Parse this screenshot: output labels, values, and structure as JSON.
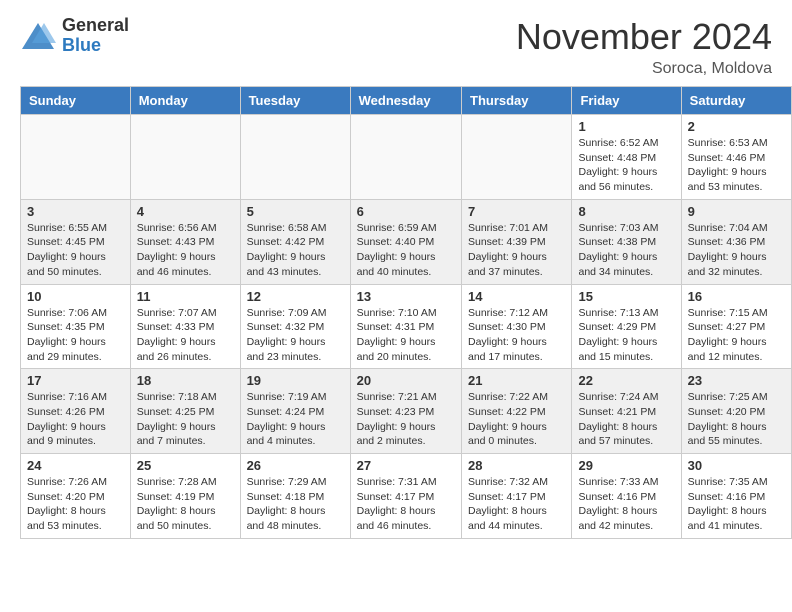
{
  "logo": {
    "general": "General",
    "blue": "Blue"
  },
  "title": "November 2024",
  "location": "Soroca, Moldova",
  "days_of_week": [
    "Sunday",
    "Monday",
    "Tuesday",
    "Wednesday",
    "Thursday",
    "Friday",
    "Saturday"
  ],
  "weeks": [
    [
      {
        "day": "",
        "info": ""
      },
      {
        "day": "",
        "info": ""
      },
      {
        "day": "",
        "info": ""
      },
      {
        "day": "",
        "info": ""
      },
      {
        "day": "",
        "info": ""
      },
      {
        "day": "1",
        "info": "Sunrise: 6:52 AM\nSunset: 4:48 PM\nDaylight: 9 hours and 56 minutes."
      },
      {
        "day": "2",
        "info": "Sunrise: 6:53 AM\nSunset: 4:46 PM\nDaylight: 9 hours and 53 minutes."
      }
    ],
    [
      {
        "day": "3",
        "info": "Sunrise: 6:55 AM\nSunset: 4:45 PM\nDaylight: 9 hours and 50 minutes."
      },
      {
        "day": "4",
        "info": "Sunrise: 6:56 AM\nSunset: 4:43 PM\nDaylight: 9 hours and 46 minutes."
      },
      {
        "day": "5",
        "info": "Sunrise: 6:58 AM\nSunset: 4:42 PM\nDaylight: 9 hours and 43 minutes."
      },
      {
        "day": "6",
        "info": "Sunrise: 6:59 AM\nSunset: 4:40 PM\nDaylight: 9 hours and 40 minutes."
      },
      {
        "day": "7",
        "info": "Sunrise: 7:01 AM\nSunset: 4:39 PM\nDaylight: 9 hours and 37 minutes."
      },
      {
        "day": "8",
        "info": "Sunrise: 7:03 AM\nSunset: 4:38 PM\nDaylight: 9 hours and 34 minutes."
      },
      {
        "day": "9",
        "info": "Sunrise: 7:04 AM\nSunset: 4:36 PM\nDaylight: 9 hours and 32 minutes."
      }
    ],
    [
      {
        "day": "10",
        "info": "Sunrise: 7:06 AM\nSunset: 4:35 PM\nDaylight: 9 hours and 29 minutes."
      },
      {
        "day": "11",
        "info": "Sunrise: 7:07 AM\nSunset: 4:33 PM\nDaylight: 9 hours and 26 minutes."
      },
      {
        "day": "12",
        "info": "Sunrise: 7:09 AM\nSunset: 4:32 PM\nDaylight: 9 hours and 23 minutes."
      },
      {
        "day": "13",
        "info": "Sunrise: 7:10 AM\nSunset: 4:31 PM\nDaylight: 9 hours and 20 minutes."
      },
      {
        "day": "14",
        "info": "Sunrise: 7:12 AM\nSunset: 4:30 PM\nDaylight: 9 hours and 17 minutes."
      },
      {
        "day": "15",
        "info": "Sunrise: 7:13 AM\nSunset: 4:29 PM\nDaylight: 9 hours and 15 minutes."
      },
      {
        "day": "16",
        "info": "Sunrise: 7:15 AM\nSunset: 4:27 PM\nDaylight: 9 hours and 12 minutes."
      }
    ],
    [
      {
        "day": "17",
        "info": "Sunrise: 7:16 AM\nSunset: 4:26 PM\nDaylight: 9 hours and 9 minutes."
      },
      {
        "day": "18",
        "info": "Sunrise: 7:18 AM\nSunset: 4:25 PM\nDaylight: 9 hours and 7 minutes."
      },
      {
        "day": "19",
        "info": "Sunrise: 7:19 AM\nSunset: 4:24 PM\nDaylight: 9 hours and 4 minutes."
      },
      {
        "day": "20",
        "info": "Sunrise: 7:21 AM\nSunset: 4:23 PM\nDaylight: 9 hours and 2 minutes."
      },
      {
        "day": "21",
        "info": "Sunrise: 7:22 AM\nSunset: 4:22 PM\nDaylight: 9 hours and 0 minutes."
      },
      {
        "day": "22",
        "info": "Sunrise: 7:24 AM\nSunset: 4:21 PM\nDaylight: 8 hours and 57 minutes."
      },
      {
        "day": "23",
        "info": "Sunrise: 7:25 AM\nSunset: 4:20 PM\nDaylight: 8 hours and 55 minutes."
      }
    ],
    [
      {
        "day": "24",
        "info": "Sunrise: 7:26 AM\nSunset: 4:20 PM\nDaylight: 8 hours and 53 minutes."
      },
      {
        "day": "25",
        "info": "Sunrise: 7:28 AM\nSunset: 4:19 PM\nDaylight: 8 hours and 50 minutes."
      },
      {
        "day": "26",
        "info": "Sunrise: 7:29 AM\nSunset: 4:18 PM\nDaylight: 8 hours and 48 minutes."
      },
      {
        "day": "27",
        "info": "Sunrise: 7:31 AM\nSunset: 4:17 PM\nDaylight: 8 hours and 46 minutes."
      },
      {
        "day": "28",
        "info": "Sunrise: 7:32 AM\nSunset: 4:17 PM\nDaylight: 8 hours and 44 minutes."
      },
      {
        "day": "29",
        "info": "Sunrise: 7:33 AM\nSunset: 4:16 PM\nDaylight: 8 hours and 42 minutes."
      },
      {
        "day": "30",
        "info": "Sunrise: 7:35 AM\nSunset: 4:16 PM\nDaylight: 8 hours and 41 minutes."
      }
    ]
  ]
}
